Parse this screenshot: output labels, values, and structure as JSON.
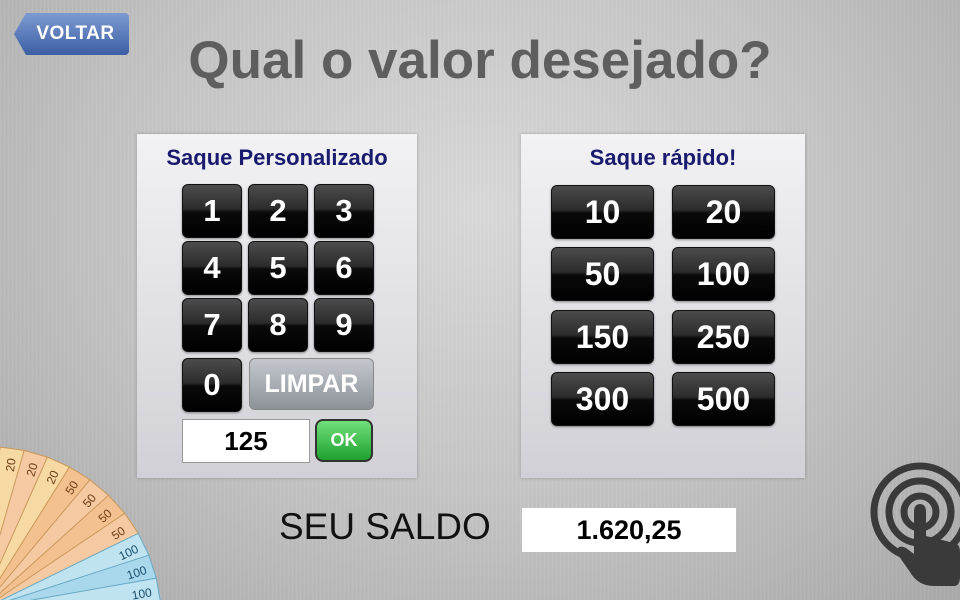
{
  "header": {
    "back_label": "VOLTAR",
    "title": "Qual o valor desejado?"
  },
  "custom_withdrawal": {
    "title": "Saque Personalizado",
    "keys": [
      "1",
      "2",
      "3",
      "4",
      "5",
      "6",
      "7",
      "8",
      "9",
      "0"
    ],
    "clear_label": "LIMPAR",
    "amount_value": "125",
    "ok_label": "OK"
  },
  "quick_withdrawal": {
    "title": "Saque rápido!",
    "amounts": [
      "10",
      "20",
      "50",
      "100",
      "150",
      "250",
      "300",
      "500"
    ]
  },
  "balance": {
    "label": "SEU SALDO",
    "value": "1.620,25"
  },
  "decor": {
    "banknotes": [
      "20",
      "50",
      "100"
    ]
  },
  "colors": {
    "title_text": "#5e5e5e",
    "panel_title": "#1a1a6e",
    "back_button": "#4a6db0",
    "ok_button": "#2fb23c"
  }
}
